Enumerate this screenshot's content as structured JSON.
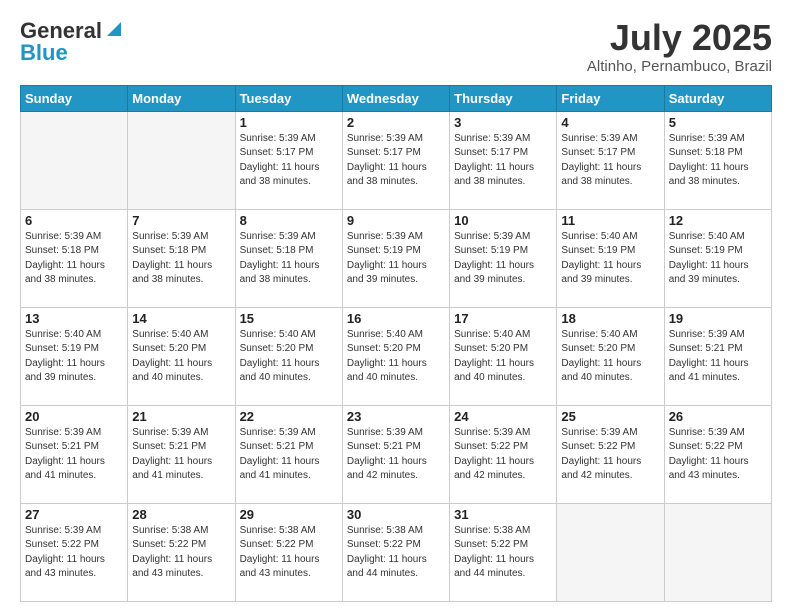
{
  "header": {
    "logo_general": "General",
    "logo_blue": "Blue",
    "month_title": "July 2025",
    "location": "Altinho, Pernambuco, Brazil"
  },
  "days_of_week": [
    "Sunday",
    "Monday",
    "Tuesday",
    "Wednesday",
    "Thursday",
    "Friday",
    "Saturday"
  ],
  "weeks": [
    [
      {
        "day": "",
        "info": ""
      },
      {
        "day": "",
        "info": ""
      },
      {
        "day": "1",
        "info": "Sunrise: 5:39 AM\nSunset: 5:17 PM\nDaylight: 11 hours and 38 minutes."
      },
      {
        "day": "2",
        "info": "Sunrise: 5:39 AM\nSunset: 5:17 PM\nDaylight: 11 hours and 38 minutes."
      },
      {
        "day": "3",
        "info": "Sunrise: 5:39 AM\nSunset: 5:17 PM\nDaylight: 11 hours and 38 minutes."
      },
      {
        "day": "4",
        "info": "Sunrise: 5:39 AM\nSunset: 5:17 PM\nDaylight: 11 hours and 38 minutes."
      },
      {
        "day": "5",
        "info": "Sunrise: 5:39 AM\nSunset: 5:18 PM\nDaylight: 11 hours and 38 minutes."
      }
    ],
    [
      {
        "day": "6",
        "info": "Sunrise: 5:39 AM\nSunset: 5:18 PM\nDaylight: 11 hours and 38 minutes."
      },
      {
        "day": "7",
        "info": "Sunrise: 5:39 AM\nSunset: 5:18 PM\nDaylight: 11 hours and 38 minutes."
      },
      {
        "day": "8",
        "info": "Sunrise: 5:39 AM\nSunset: 5:18 PM\nDaylight: 11 hours and 38 minutes."
      },
      {
        "day": "9",
        "info": "Sunrise: 5:39 AM\nSunset: 5:19 PM\nDaylight: 11 hours and 39 minutes."
      },
      {
        "day": "10",
        "info": "Sunrise: 5:39 AM\nSunset: 5:19 PM\nDaylight: 11 hours and 39 minutes."
      },
      {
        "day": "11",
        "info": "Sunrise: 5:40 AM\nSunset: 5:19 PM\nDaylight: 11 hours and 39 minutes."
      },
      {
        "day": "12",
        "info": "Sunrise: 5:40 AM\nSunset: 5:19 PM\nDaylight: 11 hours and 39 minutes."
      }
    ],
    [
      {
        "day": "13",
        "info": "Sunrise: 5:40 AM\nSunset: 5:19 PM\nDaylight: 11 hours and 39 minutes."
      },
      {
        "day": "14",
        "info": "Sunrise: 5:40 AM\nSunset: 5:20 PM\nDaylight: 11 hours and 40 minutes."
      },
      {
        "day": "15",
        "info": "Sunrise: 5:40 AM\nSunset: 5:20 PM\nDaylight: 11 hours and 40 minutes."
      },
      {
        "day": "16",
        "info": "Sunrise: 5:40 AM\nSunset: 5:20 PM\nDaylight: 11 hours and 40 minutes."
      },
      {
        "day": "17",
        "info": "Sunrise: 5:40 AM\nSunset: 5:20 PM\nDaylight: 11 hours and 40 minutes."
      },
      {
        "day": "18",
        "info": "Sunrise: 5:40 AM\nSunset: 5:20 PM\nDaylight: 11 hours and 40 minutes."
      },
      {
        "day": "19",
        "info": "Sunrise: 5:39 AM\nSunset: 5:21 PM\nDaylight: 11 hours and 41 minutes."
      }
    ],
    [
      {
        "day": "20",
        "info": "Sunrise: 5:39 AM\nSunset: 5:21 PM\nDaylight: 11 hours and 41 minutes."
      },
      {
        "day": "21",
        "info": "Sunrise: 5:39 AM\nSunset: 5:21 PM\nDaylight: 11 hours and 41 minutes."
      },
      {
        "day": "22",
        "info": "Sunrise: 5:39 AM\nSunset: 5:21 PM\nDaylight: 11 hours and 41 minutes."
      },
      {
        "day": "23",
        "info": "Sunrise: 5:39 AM\nSunset: 5:21 PM\nDaylight: 11 hours and 42 minutes."
      },
      {
        "day": "24",
        "info": "Sunrise: 5:39 AM\nSunset: 5:22 PM\nDaylight: 11 hours and 42 minutes."
      },
      {
        "day": "25",
        "info": "Sunrise: 5:39 AM\nSunset: 5:22 PM\nDaylight: 11 hours and 42 minutes."
      },
      {
        "day": "26",
        "info": "Sunrise: 5:39 AM\nSunset: 5:22 PM\nDaylight: 11 hours and 43 minutes."
      }
    ],
    [
      {
        "day": "27",
        "info": "Sunrise: 5:39 AM\nSunset: 5:22 PM\nDaylight: 11 hours and 43 minutes."
      },
      {
        "day": "28",
        "info": "Sunrise: 5:38 AM\nSunset: 5:22 PM\nDaylight: 11 hours and 43 minutes."
      },
      {
        "day": "29",
        "info": "Sunrise: 5:38 AM\nSunset: 5:22 PM\nDaylight: 11 hours and 43 minutes."
      },
      {
        "day": "30",
        "info": "Sunrise: 5:38 AM\nSunset: 5:22 PM\nDaylight: 11 hours and 44 minutes."
      },
      {
        "day": "31",
        "info": "Sunrise: 5:38 AM\nSunset: 5:22 PM\nDaylight: 11 hours and 44 minutes."
      },
      {
        "day": "",
        "info": ""
      },
      {
        "day": "",
        "info": ""
      }
    ]
  ]
}
